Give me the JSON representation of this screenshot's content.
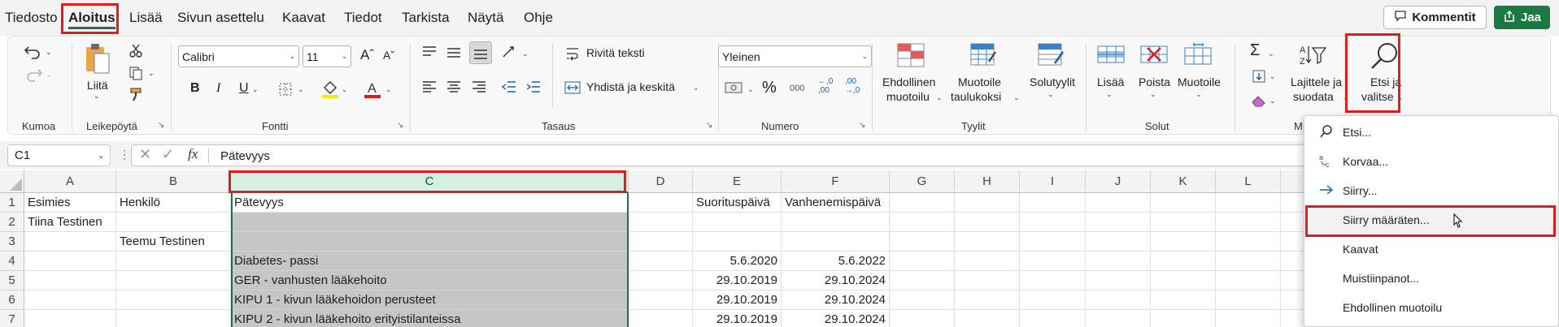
{
  "tabs": [
    "Tiedosto",
    "Aloitus",
    "Lisää",
    "Sivun asettelu",
    "Kaavat",
    "Tiedot",
    "Tarkista",
    "Näytä",
    "Ohje"
  ],
  "active_tab": "Aloitus",
  "header_buttons": {
    "comment": "Kommentit",
    "share": "Jaa"
  },
  "ribbon": {
    "undo_group": "Kumoa",
    "clipboard": {
      "label": "Leikepöytä",
      "paste": "Liitä"
    },
    "font": {
      "label": "Fontti",
      "name": "Calibri",
      "size": "11"
    },
    "alignment": {
      "label": "Tasaus",
      "wrap": "Rivitä teksti",
      "merge": "Yhdistä ja keskitä"
    },
    "number": {
      "label": "Numero",
      "format": "Yleinen"
    },
    "styles": {
      "label": "Tyylit",
      "conditional": [
        "Ehdollinen",
        "muotoilu"
      ],
      "format_table": [
        "Muotoile",
        "taulukoksi"
      ],
      "cell_styles": "Solutyylit"
    },
    "cells": {
      "label": "Solut",
      "insert": "Lisää",
      "delete": "Poista",
      "format": "Muotoile"
    },
    "editing": {
      "label_short": "M",
      "sort": [
        "Lajittele ja",
        "suodata"
      ],
      "find": [
        "Etsi ja",
        "valitse"
      ]
    }
  },
  "formula_bar": {
    "name_box": "C1",
    "fx": "fx",
    "value": "Pätevyys"
  },
  "columns": [
    "A",
    "B",
    "C",
    "D",
    "E",
    "F",
    "G",
    "H",
    "I",
    "J",
    "K",
    "L"
  ],
  "rows": [
    {
      "n": "1",
      "cells": [
        "Esimies",
        "Henkilö",
        "Pätevyys",
        "",
        "Suorituspäivä",
        "Vanhenemispäivä"
      ]
    },
    {
      "n": "2",
      "cells": [
        "Tiina Testinen",
        "",
        "",
        "",
        "",
        ""
      ]
    },
    {
      "n": "3",
      "cells": [
        "",
        "Teemu Testinen",
        "",
        "",
        "",
        ""
      ]
    },
    {
      "n": "4",
      "cells": [
        "",
        "",
        "Diabetes- passi",
        "",
        "5.6.2020",
        "5.6.2022"
      ]
    },
    {
      "n": "5",
      "cells": [
        "",
        "",
        "GER - vanhusten lääkehoito",
        "",
        "29.10.2019",
        "29.10.2024"
      ]
    },
    {
      "n": "6",
      "cells": [
        "",
        "",
        "KIPU 1 - kivun lääkehoidon perusteet",
        "",
        "29.10.2019",
        "29.10.2024"
      ]
    },
    {
      "n": "7",
      "cells": [
        "",
        "",
        "KIPU 2 - kivun lääkehoito erityistilanteissa",
        "",
        "29.10.2019",
        "29.10.2024"
      ]
    }
  ],
  "find_menu": [
    {
      "icon": "search-icon",
      "label": "Etsi..."
    },
    {
      "icon": "replace-icon",
      "label": "Korvaa..."
    },
    {
      "icon": "arrow-right-icon",
      "label": "Siirry..."
    },
    {
      "icon": "",
      "label": "Siirry määräten..."
    },
    {
      "icon": "",
      "label": "Kaavat"
    },
    {
      "icon": "",
      "label": "Muistiinpanot..."
    },
    {
      "icon": "",
      "label": "Ehdollinen muotoilu"
    }
  ],
  "colors": {
    "accent": "#217346",
    "highlight": "#e21b1b",
    "share_bg": "#1b7a43"
  }
}
